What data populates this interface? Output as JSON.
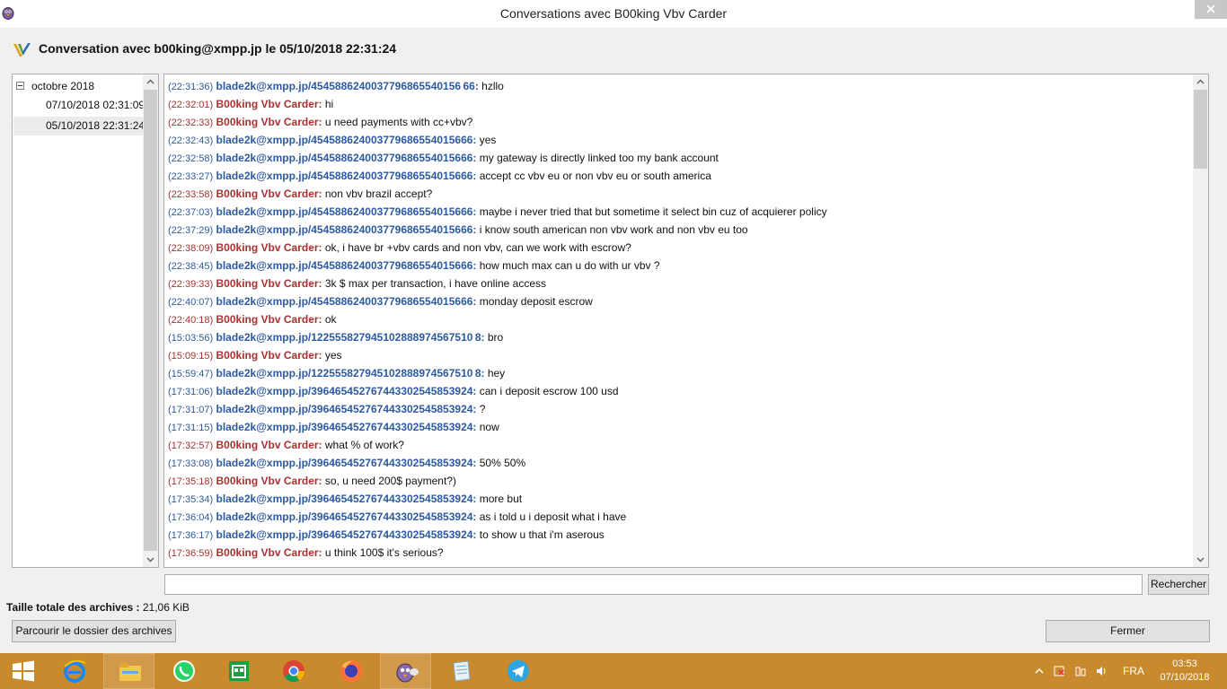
{
  "window": {
    "title": "Conversations avec B00king Vbv Carder"
  },
  "header": {
    "title": "Conversation avec b00king@xmpp.jp le 05/10/2018 22:31:24"
  },
  "tree": {
    "parent_label": "octobre 2018",
    "items": [
      {
        "label": "07/10/2018 02:31:09",
        "selected": false
      },
      {
        "label": "05/10/2018 22:31:24",
        "selected": true
      }
    ]
  },
  "messages": [
    {
      "time": "(22:31:36)",
      "sender": "blade2k@xmpp.jp/4545886240037796865540156 66:",
      "text": " hzllo",
      "dir": "in"
    },
    {
      "time": "(22:32:01)",
      "sender": "B00king Vbv Carder:",
      "text": " hi",
      "dir": "out"
    },
    {
      "time": "(22:32:33)",
      "sender": "B00king Vbv Carder:",
      "text": " u need payments with cc+vbv?",
      "dir": "out"
    },
    {
      "time": "(22:32:43)",
      "sender": "blade2k@xmpp.jp/454588624003779686554015666:",
      "text": " yes",
      "dir": "in"
    },
    {
      "time": "(22:32:58)",
      "sender": "blade2k@xmpp.jp/454588624003779686554015666:",
      "text": " my gateway is directly linked too my bank account",
      "dir": "in"
    },
    {
      "time": "(22:33:27)",
      "sender": "blade2k@xmpp.jp/454588624003779686554015666:",
      "text": " accept cc vbv eu or non vbv eu or south america",
      "dir": "in"
    },
    {
      "time": "(22:33:58)",
      "sender": "B00king Vbv Carder:",
      "text": " non vbv brazil accept?",
      "dir": "out"
    },
    {
      "time": "(22:37:03)",
      "sender": "blade2k@xmpp.jp/454588624003779686554015666:",
      "text": " maybe i never tried that but sometime it select bin cuz of acquierer policy",
      "dir": "in"
    },
    {
      "time": "(22:37:29)",
      "sender": "blade2k@xmpp.jp/454588624003779686554015666:",
      "text": " i know south american non vbv work and non vbv eu too",
      "dir": "in"
    },
    {
      "time": "(22:38:09)",
      "sender": "B00king Vbv Carder:",
      "text": " ok, i have br +vbv cards and non vbv, can we work with escrow?",
      "dir": "out"
    },
    {
      "time": "(22:38:45)",
      "sender": "blade2k@xmpp.jp/454588624003779686554015666:",
      "text": " how much max can u do with ur vbv ?",
      "dir": "in"
    },
    {
      "time": "(22:39:33)",
      "sender": "B00king Vbv Carder:",
      "text": " 3k $ max per transaction, i have online access",
      "dir": "out"
    },
    {
      "time": "(22:40:07)",
      "sender": "blade2k@xmpp.jp/454588624003779686554015666:",
      "text": " monday deposit escrow",
      "dir": "in"
    },
    {
      "time": "(22:40:18)",
      "sender": "B00king Vbv Carder:",
      "text": " ok",
      "dir": "out"
    },
    {
      "time": "(15:03:56)",
      "sender": "blade2k@xmpp.jp/122555827945102888974567510 8:",
      "text": " bro",
      "dir": "in"
    },
    {
      "time": "(15:09:15)",
      "sender": "B00king Vbv Carder:",
      "text": " yes",
      "dir": "out"
    },
    {
      "time": "(15:59:47)",
      "sender": "blade2k@xmpp.jp/122555827945102888974567510 8:",
      "text": " hey",
      "dir": "in"
    },
    {
      "time": "(17:31:06)",
      "sender": "blade2k@xmpp.jp/396465452767443302545853924:",
      "text": " can i deposit escrow 100 usd",
      "dir": "in"
    },
    {
      "time": "(17:31:07)",
      "sender": "blade2k@xmpp.jp/396465452767443302545853924:",
      "text": "  ?",
      "dir": "in"
    },
    {
      "time": "(17:31:15)",
      "sender": "blade2k@xmpp.jp/396465452767443302545853924:",
      "text": " now",
      "dir": "in"
    },
    {
      "time": "(17:32:57)",
      "sender": "B00king Vbv Carder:",
      "text": " what % of work?",
      "dir": "out"
    },
    {
      "time": "(17:33:08)",
      "sender": "blade2k@xmpp.jp/396465452767443302545853924:",
      "text": " 50% 50%",
      "dir": "in"
    },
    {
      "time": "(17:35:18)",
      "sender": "B00king Vbv Carder:",
      "text": " so, u need 200$ payment?)",
      "dir": "out"
    },
    {
      "time": "(17:35:34)",
      "sender": "blade2k@xmpp.jp/396465452767443302545853924:",
      "text": " more but",
      "dir": "in"
    },
    {
      "time": "(17:36:04)",
      "sender": "blade2k@xmpp.jp/396465452767443302545853924:",
      "text": " as i told u i deposit what i have",
      "dir": "in"
    },
    {
      "time": "(17:36:17)",
      "sender": "blade2k@xmpp.jp/396465452767443302545853924:",
      "text": " to show u that i'm aserous",
      "dir": "in"
    },
    {
      "time": "(17:36:59)",
      "sender": "B00king Vbv Carder:",
      "text": " u think 100$ it's serious?",
      "dir": "out"
    }
  ],
  "search": {
    "value": "",
    "button_label": "Rechercher"
  },
  "archive": {
    "size_label": "Taille totale des archives :",
    "size_value": " 21,06 KiB",
    "browse_label": "Parcourir le dossier des archives",
    "close_label": "Fermer"
  },
  "taskbar": {
    "lang": "FRA",
    "time": "03:53",
    "date": "07/10/2018"
  }
}
